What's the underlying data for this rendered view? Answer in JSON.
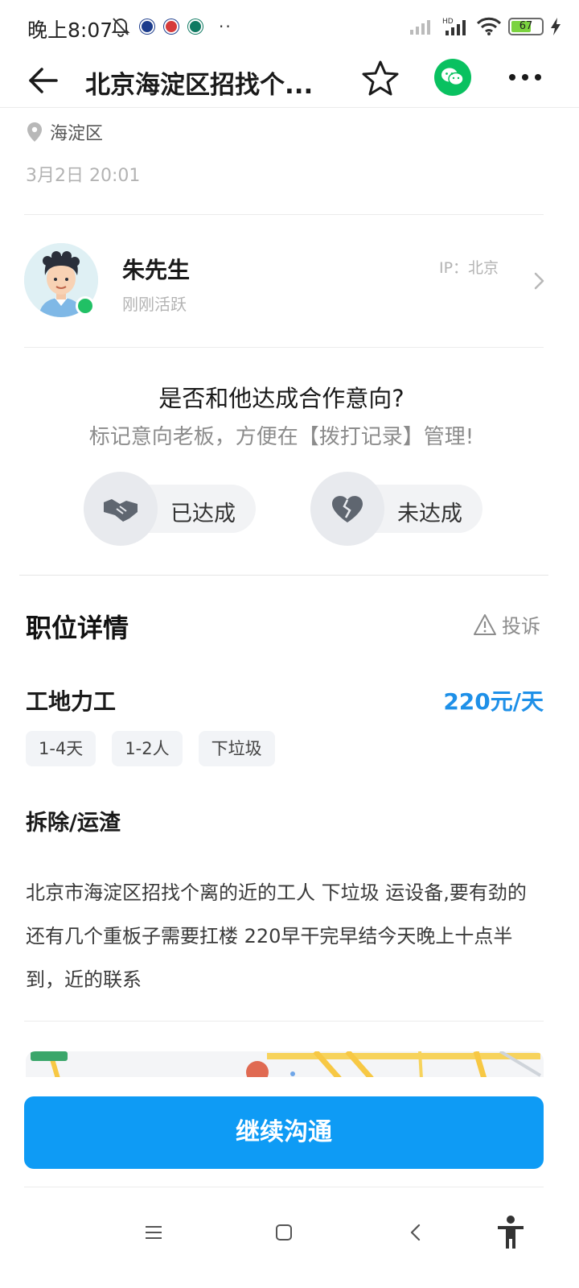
{
  "status_bar": {
    "time": "晚上8:07",
    "battery": "67",
    "battery_level": 0.67
  },
  "nav": {
    "title": "北京海淀区招找个..."
  },
  "location": "海淀区",
  "post_time": "3月2日 20:01",
  "boss": {
    "name": "朱先生",
    "active": "刚刚活跃",
    "ip": "IP：北京"
  },
  "cooperation": {
    "question": "是否和他达成合作意向?",
    "hint": "标记意向老板，方便在【拨打记录】管理!",
    "yes_label": "已达成",
    "no_label": "未达成"
  },
  "job": {
    "section_title": "职位详情",
    "report_label": "投诉",
    "name": "工地力工",
    "pay": "220元/天",
    "tags": [
      "1-4天",
      "1-2人",
      "下垃圾"
    ],
    "category": "拆除/运渣",
    "description": "北京市海淀区招找个离的近的工人 下垃圾 运设备,要有劲的还有几个重板子需要扛楼 220早干完早结今天晚上十点半到，近的联系"
  },
  "cta": {
    "label": "继续沟通"
  },
  "colors": {
    "accent": "#0e9bf5",
    "pay": "#1e90e8",
    "wechat": "#09c160",
    "online": "#21c065"
  }
}
